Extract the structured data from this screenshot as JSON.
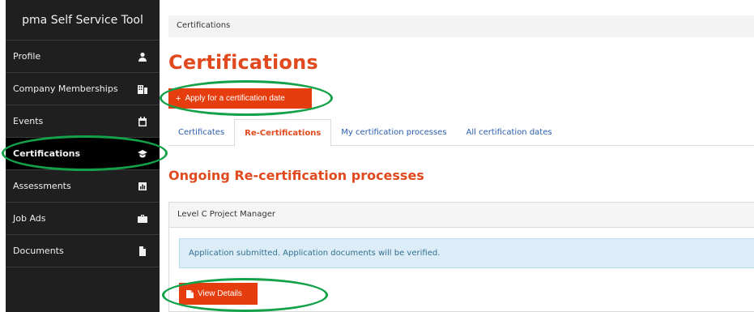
{
  "sidebar": {
    "brand": "pma Self Service Tool",
    "items": [
      {
        "label": "Profile",
        "icon": "user-icon"
      },
      {
        "label": "Company Memberships",
        "icon": "building-icon"
      },
      {
        "label": "Events",
        "icon": "calendar-icon"
      },
      {
        "label": "Certifications",
        "icon": "graduation-cap-icon",
        "active": true
      },
      {
        "label": "Assessments",
        "icon": "bar-chart-icon"
      },
      {
        "label": "Job Ads",
        "icon": "briefcase-icon"
      },
      {
        "label": "Documents",
        "icon": "file-icon"
      }
    ]
  },
  "breadcrumb": "Certifications",
  "page_title": "Certifications",
  "apply_button": {
    "icon": "+",
    "label": "Apply for a certification date"
  },
  "tabs": [
    {
      "label": "Certificates"
    },
    {
      "label": "Re-Certifications",
      "active": true
    },
    {
      "label": "My certification processes"
    },
    {
      "label": "All certification dates"
    }
  ],
  "section_title": "Ongoing Re-certification processes",
  "panel": {
    "heading": "Level C Project Manager",
    "alert": "Application submitted. Application documents will be verified.",
    "details_button": "View Details"
  },
  "colors": {
    "accent": "#e53d0e",
    "title": "#e04a1e",
    "sidebar": "#1f1f1f",
    "annotation": "#14a14a",
    "link": "#2a5dad"
  }
}
